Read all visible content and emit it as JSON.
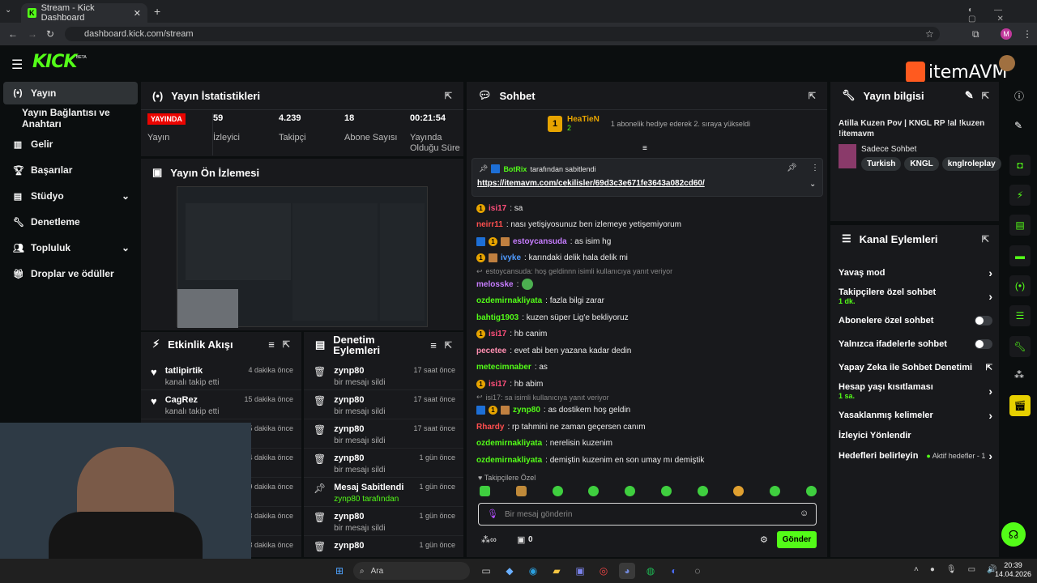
{
  "browser": {
    "tab_title": "Stream - Kick Dashboard",
    "url": "dashboard.kick.com/stream",
    "profile_initial": "M"
  },
  "brand": {
    "logo": "KICK",
    "beta": "BETA",
    "accent": "#53fc18"
  },
  "sidebar": {
    "items": [
      {
        "label": "Yayın",
        "icon": "broadcast-icon"
      },
      {
        "label": "Yayın Bağlantısı ve Anahtarı"
      },
      {
        "label": "Gelir",
        "icon": "chart-icon"
      },
      {
        "label": "Başarılar",
        "icon": "trophy-icon"
      },
      {
        "label": "Stüdyo",
        "icon": "studio-icon"
      },
      {
        "label": "Denetleme",
        "icon": "wrench-icon"
      },
      {
        "label": "Topluluk",
        "icon": "people-icon"
      },
      {
        "label": "Droplar ve ödüller",
        "icon": "gift-icon"
      }
    ]
  },
  "stats": {
    "title": "Yayın İstatistikleri",
    "live_badge": "YAYINDA",
    "cells": [
      {
        "value": "",
        "label": "Yayın"
      },
      {
        "value": "59",
        "label": "İzleyici"
      },
      {
        "value": "4.239",
        "label": "Takipçi"
      },
      {
        "value": "18",
        "label": "Abone Sayısı"
      },
      {
        "value": "00:21:54",
        "label": "Yayında Olduğu Süre"
      }
    ]
  },
  "preview": {
    "title": "Yayın Ön İzlemesi"
  },
  "events": {
    "title": "Etkinlik Akışı",
    "rows": [
      {
        "name": "tatlipirtik",
        "sub": "kanalı takip etti",
        "time": "4 dakika önce"
      },
      {
        "name": "CagRez",
        "sub": "kanalı takip etti",
        "time": "15 dakika önce"
      },
      {
        "name": "",
        "sub": "",
        "time": "5 dakika önce"
      },
      {
        "name": "",
        "sub": "",
        "time": "4 dakika önce"
      },
      {
        "name": "",
        "sub": "",
        "time": "9 dakika önce"
      },
      {
        "name": "",
        "sub": "",
        "time": "3 dakika önce"
      },
      {
        "name": "",
        "sub": "",
        "time": "3 dakika önce"
      }
    ]
  },
  "moderation": {
    "title": "Denetim Eylemleri",
    "rows": [
      {
        "name": "zynp80",
        "sub": "bir mesajı sildi",
        "time": "17 saat önce"
      },
      {
        "name": "zynp80",
        "sub": "bir mesajı sildi",
        "time": "17 saat önce"
      },
      {
        "name": "zynp80",
        "sub": "bir mesajı sildi",
        "time": "17 saat önce"
      },
      {
        "name": "zynp80",
        "sub": "bir mesajı sildi",
        "time": "1 gün önce"
      },
      {
        "name": "Mesaj Sabitlendi",
        "sub": "zynp80 tarafından",
        "time": "1 gün önce"
      },
      {
        "name": "zynp80",
        "sub": "bir mesajı sildi",
        "time": "1 gün önce"
      },
      {
        "name": "zynp80",
        "sub": "",
        "time": "1 gün önce"
      }
    ]
  },
  "chat": {
    "title": "Sohbet",
    "gift_user": "HeaTieN",
    "gift_count": "2",
    "gift_text": "1 abonelik hediye ederek 2. sıraya yükseldi",
    "pinned_by": "BotRix",
    "pinned_suffix": "tarafından sabitlendi",
    "pinned_link": "https://itemavm.com/cekilisler/69d3c3e671fe3643a082cd60/",
    "messages": [
      {
        "user": "isi17",
        "color": "#ff4f7b",
        "text": ": sa"
      },
      {
        "user": "neirr11",
        "color": "#ff4f4f",
        "text": ": nası yetişiyosunuz ben izlemeye yetişemiyorum"
      },
      {
        "user": "estoycansuda",
        "color": "#c77dff",
        "text": ": as isim hg"
      },
      {
        "user": "ivyke",
        "color": "#4f9bff",
        "text": ": karındaki delik hala delik mi"
      },
      {
        "reply": "estoycansuda: hoş geldinnn isimli kullanıcıya yanıt veriyor"
      },
      {
        "user": "melosske",
        "color": "#c77dff",
        "text": ":"
      },
      {
        "user": "ozdemirnakliyata",
        "color": "#53fc18",
        "text": ": fazla bilgi zarar"
      },
      {
        "user": "bahtig1903",
        "color": "#53fc18",
        "text": ": kuzen süper Lig'e bekliyoruz"
      },
      {
        "user": "isi17",
        "color": "#ff4f7b",
        "text": ": hb canim"
      },
      {
        "user": "pecetee",
        "color": "#ff8fb1",
        "text": ": evet abi ben yazana kadar dedin"
      },
      {
        "user": "metecimnaber",
        "color": "#53fc18",
        "text": ": as"
      },
      {
        "user": "isi17",
        "color": "#ff4f7b",
        "text": ": hb abim"
      },
      {
        "reply": "isi17: sa isimli kullanıcıya yanıt veriyor"
      },
      {
        "user": "zynp80",
        "color": "#53fc18",
        "text": ": as dostikem hoş geldin"
      },
      {
        "user": "Rhardy",
        "color": "#ff4f4f",
        "text": ": rp tahmini ne zaman geçersen canım"
      },
      {
        "user": "ozdemirnakliyata",
        "color": "#53fc18",
        "text": ": nerelisin kuzenim"
      },
      {
        "user": "ozdemirnakliyata",
        "color": "#53fc18",
        "text": ": demiştin kuzenim en son umay mı demiştik"
      }
    ],
    "followers_only": "Takipçilere Özel",
    "input_placeholder": "Bir mesaj gönderin",
    "points": "0",
    "send_label": "Gönder"
  },
  "info": {
    "title": "Yayın bilgisi",
    "stream_title": "Atilla Kuzen Pov | KNGL RP !al !kuzen !itemavm",
    "category": "Sadece Sohbet",
    "tags": [
      "Turkish",
      "KNGL",
      "knglroleplay"
    ],
    "overlay_brand": "itemAVM"
  },
  "channel_actions": {
    "title": "Kanal Eylemleri",
    "items": [
      {
        "label": "Yavaş mod",
        "sub": "",
        "control": "chevron"
      },
      {
        "label": "Takipçilere özel sohbet",
        "sub": "1 dk.",
        "control": "chevron"
      },
      {
        "label": "Abonelere özel sohbet",
        "sub": "",
        "control": "toggle"
      },
      {
        "label": "Yalnızca ifadelerle sohbet",
        "sub": "",
        "control": "toggle"
      },
      {
        "label": "Yapay Zeka ile Sohbet Denetimi",
        "sub": "",
        "control": "external"
      },
      {
        "label": "Hesap yaşı kısıtlaması",
        "sub": "1 sa.",
        "control": "chevron"
      },
      {
        "label": "Yasaklanmış kelimeler",
        "sub": "",
        "control": "chevron"
      },
      {
        "label": "İzleyici Yönlendir",
        "sub": "",
        "control": "none"
      },
      {
        "label": "Hedefleri belirleyin",
        "sub": "",
        "control": "goals"
      }
    ],
    "goals_text": "Aktif hedefler - 1"
  },
  "taskbar": {
    "search": "Ara",
    "time": "20:39",
    "date": "14.04.2026"
  }
}
